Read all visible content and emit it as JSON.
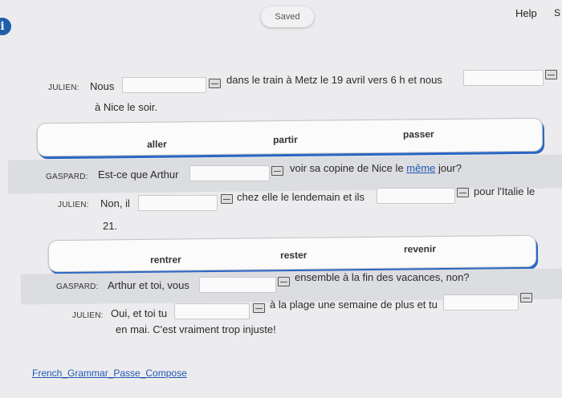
{
  "header": {
    "info_glyph": "i",
    "saved_label": "Saved",
    "help_label": "Help",
    "edge_letter": "S"
  },
  "exercise": {
    "row1": {
      "speaker": "JULIEN:",
      "text_before": "Nous",
      "text_mid": "dans le train à Metz le 19 avril vers 6 h et nous",
      "text_cont": "à Nice le soir."
    },
    "bank1": [
      "aller",
      "partir",
      "passer"
    ],
    "row2": {
      "speaker": "GASPARD:",
      "text_before": "Est-ce que Arthur",
      "text_after": "voir sa copine de Nice le",
      "link_word": "même",
      "text_end": "jour?"
    },
    "row3": {
      "speaker": "JULIEN:",
      "text_before": "Non, il",
      "text_mid": "chez elle le lendemain et ils",
      "text_after": "pour l'Italie le",
      "text_cont": "21."
    },
    "bank2": [
      "rentrer",
      "rester",
      "revenir"
    ],
    "row4": {
      "speaker": "GASPARD:",
      "text_before": "Arthur et toi, vous",
      "text_after": "ensemble à la fin des vacances, non?"
    },
    "row5": {
      "speaker": "JULIEN:",
      "text_before": "Oui, et toi tu",
      "text_mid": "à la plage une semaine de plus et tu",
      "text_cont": "en mai. C'est vraiment trop injuste!"
    }
  },
  "footer": {
    "link_label": "French_Grammar_Passe_Compose"
  },
  "colors": {
    "accent": "#2a66c4",
    "link": "#2357b6",
    "stripe": "#dcdde0"
  }
}
